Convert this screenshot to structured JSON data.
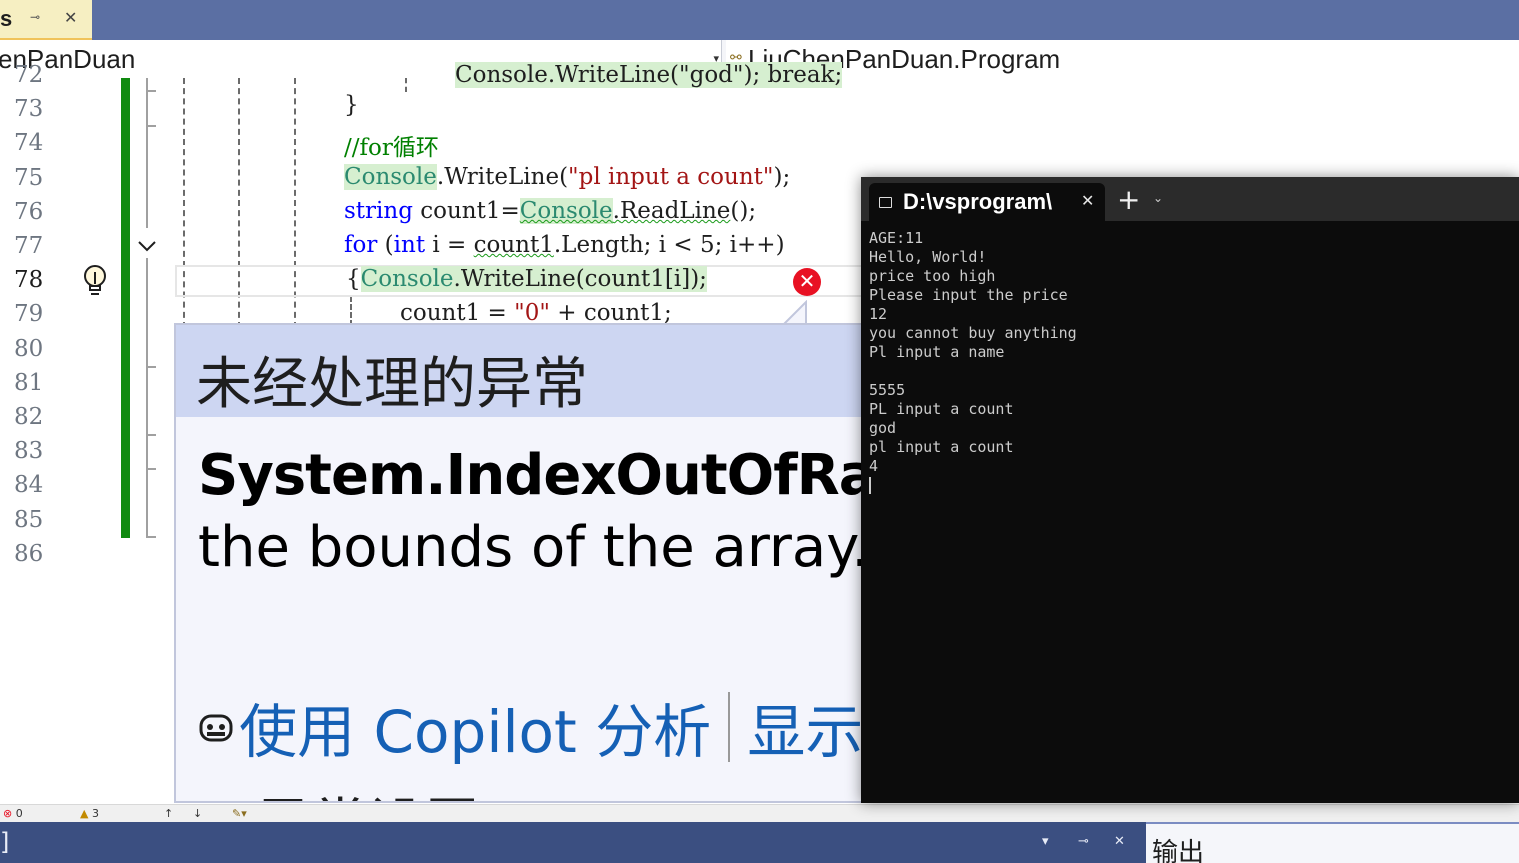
{
  "document_tab": {
    "title": "s",
    "pin_glyph": "⊸",
    "close_glyph": "✕"
  },
  "nav": {
    "project": "enPanDuan",
    "member": "LiuChenPanDuan.Program",
    "dropdown_glyph": "▾",
    "member_icon": "⚯"
  },
  "editor": {
    "line_numbers": [
      "72",
      "73",
      "74",
      "75",
      "76",
      "77",
      "78",
      "79",
      "80",
      "81",
      "82",
      "83",
      "84",
      "85",
      "86"
    ],
    "current_line": "78",
    "code": {
      "l72_tokens": [
        "Console.WriteLine(\"god\"); break;"
      ],
      "l73": "}",
      "l74": "//for循环",
      "l75_type": "Console",
      "l75_method": ".WriteLine(",
      "l75_str": "\"pl input a count\"",
      "l75_end": ");",
      "l76_kw": "string",
      "l76_var": " count1=",
      "l76_type": "Console",
      "l76_dot": ".",
      "l76_method": "ReadLine",
      "l76_end": "();",
      "l77_kw": "for",
      "l77_open": " (",
      "l77_kw2": "int",
      "l77_mid": " i = ",
      "l77_var": "count1",
      "l77_rest": ".Length; i < 5; i++)",
      "l78_brace": "{",
      "l78_type": "Console",
      "l78_rest": ".WriteLine(count1[i]);",
      "l79_a": "count1 = ",
      "l79_str": "\"0\"",
      "l79_b": " + count1;"
    },
    "error_glyph": "✕"
  },
  "exception": {
    "title": "未经处理的异常",
    "type": "System.IndexOutOfRangeException: Index was outside",
    "message": "the bounds of the array.",
    "copilot_link": "使用 Copilot 分析",
    "details_link": "显示调用堆栈",
    "settings": "异常设置"
  },
  "status": {
    "errors": "0",
    "warnings": "3",
    "up": "↑",
    "down": "↓"
  },
  "bottom": {
    "left_glyph": "]",
    "output_title": "输出",
    "dd": "▾",
    "pin": "⊸",
    "close": "✕"
  },
  "terminal": {
    "title": "D:\\vsprogram\\",
    "close_glyph": "✕",
    "plus_glyph": "+",
    "dropdown_glyph": "⌄",
    "lines": [
      "AGE:11",
      "Hello, World!",
      "price too high",
      "Please input the price",
      "12",
      "you cannot buy anything",
      "Pl input a name",
      "",
      "5555",
      "PL input a count",
      "god",
      "pl input a count",
      "4"
    ]
  },
  "colors": {
    "title_bar": "#5b6fa3",
    "change_bar": "#108a10",
    "error": "#e81123",
    "link": "#1560b5",
    "terminal_bg": "#0c0c0c"
  }
}
